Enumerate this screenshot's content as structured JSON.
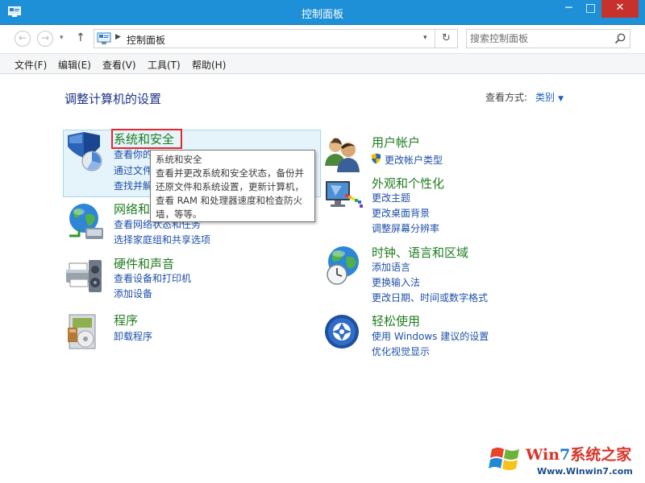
{
  "window": {
    "title": "控制面板",
    "minimize_glyph": "─",
    "maximize_glyph": "□",
    "close_glyph": "✕"
  },
  "nav": {
    "back_glyph": "←",
    "forward_glyph": "→",
    "recent_glyph": "▾",
    "up_glyph": "↑",
    "breadcrumb_sep": "▶",
    "breadcrumb": "控制面板",
    "address_drop_glyph": "▾",
    "refresh_glyph": "↻",
    "search_placeholder": "搜索控制面板"
  },
  "menu": {
    "file": "文件(F)",
    "edit": "编辑(E)",
    "view": "查看(V)",
    "tools": "工具(T)",
    "help": "帮助(H)"
  },
  "main": {
    "heading": "调整计算机的设置",
    "view_by_label": "查看方式:",
    "view_by_value": "类别",
    "view_by_arrow": "▼"
  },
  "categories": {
    "system_security": {
      "title": "系统和安全",
      "links": [
        "查看你的",
        "通过文件",
        "查找并解"
      ]
    },
    "network": {
      "title": "网络和",
      "links": [
        "查看网络状态和任务",
        "选择家庭组和共享选项"
      ]
    },
    "hardware": {
      "title": "硬件和声音",
      "links": [
        "查看设备和打印机",
        "添加设备"
      ]
    },
    "programs": {
      "title": "程序",
      "links": [
        "卸载程序"
      ]
    },
    "user_accounts": {
      "title": "用户帐户",
      "links": [
        "更改帐户类型"
      ]
    },
    "appearance": {
      "title": "外观和个性化",
      "links": [
        "更改主题",
        "更改桌面背景",
        "调整屏幕分辨率"
      ]
    },
    "clock_region": {
      "title": "时钟、语言和区域",
      "links": [
        "添加语言",
        "更换输入法",
        "更改日期、时间或数字格式"
      ]
    },
    "ease_of_access": {
      "title": "轻松使用",
      "links": [
        "使用 Windows 建议的设置",
        "优化视觉显示"
      ]
    }
  },
  "tooltip": {
    "lines": [
      "系统和安全",
      "查看并更改系统和安全状态，备份并",
      "还原文件和系统设置，更新计算机，",
      "查看 RAM 和处理器速度和检查防火",
      "墙，等等。"
    ]
  },
  "watermark": {
    "name_prefix": "Win",
    "name_seven": "7",
    "name_suffix": "系统之家",
    "url": "Www.Winwin7.com"
  },
  "colors": {
    "titlebar": "#1e90d8",
    "close_button": "#c7312c",
    "category_title": "#1f7d1f",
    "link": "#1e4fa8",
    "heading": "#1e3287",
    "highlight_border": "#e8262c"
  },
  "icons": {
    "app": "control-panel-icon",
    "system_security": "shield-chart-icon",
    "network": "globe-network-icon",
    "hardware": "printer-speaker-icon",
    "programs": "programs-box-icon",
    "user_accounts": "users-icon",
    "appearance": "monitor-palette-icon",
    "clock_region": "globe-clock-icon",
    "ease_of_access": "ease-of-access-icon",
    "search": "search-icon",
    "uac_shield": "uac-shield-icon"
  }
}
